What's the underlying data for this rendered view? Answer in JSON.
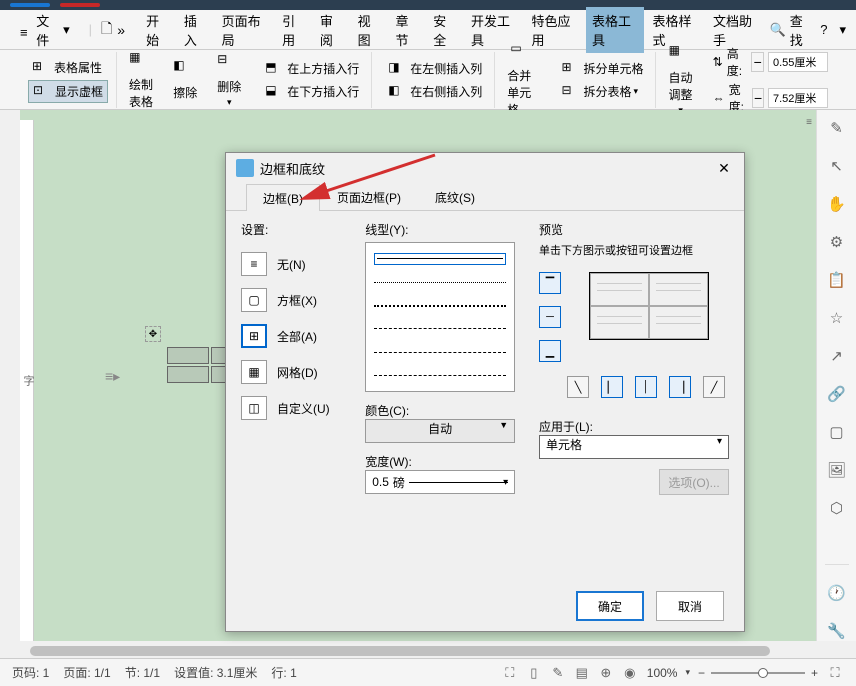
{
  "top_tabs": {
    "blue": " ",
    "red": " "
  },
  "toolbar": {
    "file": "文件",
    "tabs": [
      "开始",
      "插入",
      "页面布局",
      "引用",
      "审阅",
      "视图",
      "章节",
      "安全",
      "开发工具",
      "特色应用",
      "表格工具",
      "表格样式",
      "文档助手"
    ],
    "active_tab": "表格工具",
    "search": "查找"
  },
  "ribbon": {
    "table_props": "表格属性",
    "show_virtual": "显示虚框",
    "draw_table": "绘制表格",
    "erase": "擦除",
    "delete": "删除",
    "insert_above": "在上方插入行",
    "insert_below": "在下方插入行",
    "insert_left": "在左侧插入列",
    "insert_right": "在右侧插入列",
    "merge_cells": "合并单元格",
    "split_cells": "拆分单元格",
    "split_table": "拆分表格",
    "auto_adjust": "自动调整",
    "height_label": "高度:",
    "height_value": "0.55厘米",
    "width_label": "宽度:",
    "width_value": "7.52厘米"
  },
  "dialog": {
    "title": "边框和底纹",
    "tabs": {
      "border": "边框(B)",
      "page_border": "页面边框(P)",
      "shading": "底纹(S)"
    },
    "settings_label": "设置:",
    "options": {
      "none": "无(N)",
      "box": "方框(X)",
      "all": "全部(A)",
      "grid": "网格(D)",
      "custom": "自定义(U)"
    },
    "linetype_label": "线型(Y):",
    "color_label": "颜色(C):",
    "color_value": "自动",
    "width_label": "宽度(W):",
    "width_value": "0.5",
    "width_unit": "磅",
    "preview_label": "预览",
    "preview_hint": "单击下方图示或按钮可设置边框",
    "apply_label": "应用于(L):",
    "apply_value": "单元格",
    "options_btn": "选项(O)...",
    "ok": "确定",
    "cancel": "取消"
  },
  "status": {
    "page_num": "页码: 1",
    "page": "页面: 1/1",
    "section": "节: 1/1",
    "set_value": "设置值: 3.1厘米",
    "row": "行: 1",
    "zoom": "100%"
  },
  "left_hint": "字"
}
